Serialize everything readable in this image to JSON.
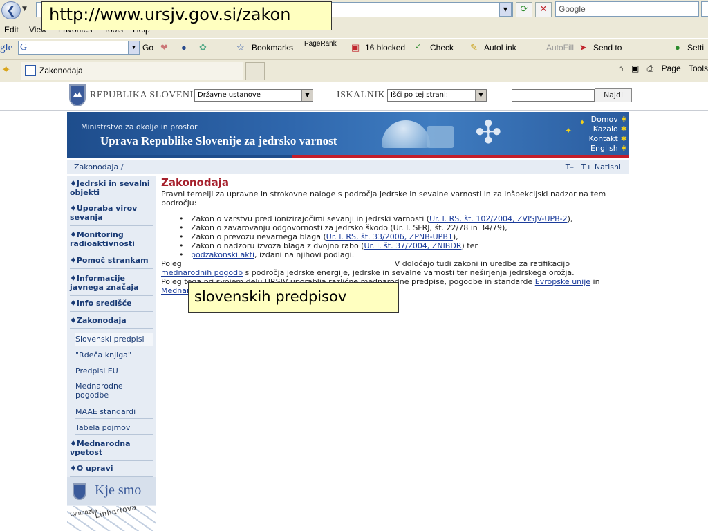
{
  "callouts": {
    "url": "http://www.ursjv.gov.si/zakon",
    "term": "slovenskih predpisov"
  },
  "browser": {
    "search_placeholder": "Google",
    "menu": [
      "Edit",
      "View",
      "Favorites",
      "Tools",
      "Help"
    ],
    "google_toolbar": {
      "logo": "gle",
      "box_logo": "G",
      "go": "Go",
      "bookmarks": "Bookmarks",
      "pagerank": "PageRank",
      "blocked": "16 blocked",
      "check": "Check",
      "autolink": "AutoLink",
      "autofill": "AutoFill",
      "sendto": "Send to",
      "settings": "Setti"
    },
    "tab_title": "Zakonodaja",
    "command_bar": {
      "page": "Page",
      "tools": "Tools"
    }
  },
  "gov_bar": {
    "title": "REPUBLIKA SLOVENIJA",
    "select_value": "Državne ustanove",
    "search_label": "ISKALNIK",
    "scope_value": "Išči po tej strani:",
    "search_button": "Najdi"
  },
  "banner": {
    "subtitle": "Ministrstvo za okolje in prostor",
    "title": "Uprava Republike Slovenije za jedrsko varnost",
    "links": [
      "Domov",
      "Kazalo",
      "Kontakt",
      "English"
    ]
  },
  "crumb": {
    "path": "Zakonodaja  /",
    "text_smaller": "T–",
    "text_larger": "T+",
    "print": "Natisni"
  },
  "sidebar": {
    "items": [
      "Jedrski in sevalni objekti",
      "Uporaba virov sevanja",
      "Monitoring radioaktivnosti",
      "Pomoč strankam",
      "Informacije javnega značaja",
      "Info središče",
      "Zakonodaja"
    ],
    "subitems": [
      "Slovenski predpisi",
      "\"Rdeča knjiga\"",
      "Predpisi EU",
      "Mednarodne pogodbe",
      "MAAE standardi",
      "Tabela pojmov"
    ],
    "items_after": [
      "Mednarodna vpetost",
      "O upravi"
    ],
    "kje_smo": "Kje smo",
    "map_street": "Linhartova",
    "map_street2": "Gimnazija"
  },
  "content": {
    "heading": "Zakonodaja",
    "intro": "Pravni temelji za upravne in strokovne naloge s področja jedrske in sevalne varnosti in za inšpekcijski nadzor na tem področju:",
    "laws": [
      {
        "text": "Zakon o varstvu pred ionizirajočimi sevanji in jedrski varnosti (",
        "link": "Ur. l. RS, št. 102/2004, ZVISJV-UPB-2",
        "after": "),"
      },
      {
        "text": "Zakon o zavarovanju odgovornosti za jedrsko škodo (Ur. l. SFRJ, št. 22/78 in 34/79),",
        "link": "",
        "after": ""
      },
      {
        "text": "Zakon o prevozu nevarnega blaga (",
        "link": "Ur. l. RS, št. 33/2006, ZPNB-UPB1",
        "after": "),"
      },
      {
        "text": "Zakon o nadzoru izvoza blaga z dvojno rabo (",
        "link": "Ur. l. št. 37/2004, ZNIBDR",
        "after": ") ter"
      },
      {
        "text": "",
        "link": "podzakonski akti",
        "after": ", izdani na njihovi podlagi."
      }
    ],
    "para2_start": "Poleg",
    "para2_mid": "V določajo tudi zakoni in uredbe za ratifikacijo",
    "para2_link": "mednarodnih pogodb",
    "para2_end": " s področja jedrske energije, jedrske in sevalne varnosti ter neširjenja jedrskega orožja.",
    "para3_start": "Poleg tega pri svojem delu URSJV uporablja različne mednarodne predpise, pogodbe in standarde ",
    "para3_link1": "Evropske unije",
    "para3_mid": " in ",
    "para3_link2": "Mednarodne agencije za atomsko energijo",
    "para3_end": "."
  }
}
